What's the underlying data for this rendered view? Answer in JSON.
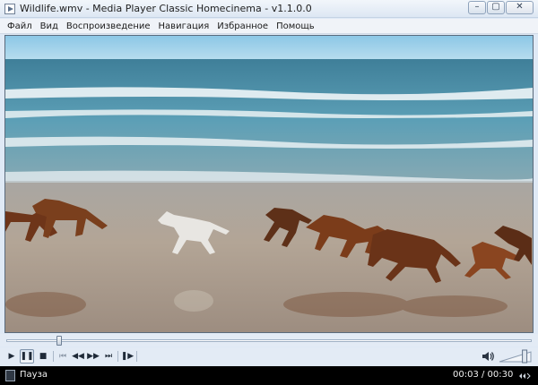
{
  "window": {
    "title": "Wildlife.wmv - Media Player Classic Homecinema - v1.1.0.0",
    "minimize_glyph": "–",
    "maximize_glyph": "▢",
    "close_glyph": "✕"
  },
  "menu": {
    "items": [
      "Файл",
      "Вид",
      "Воспроизведение",
      "Навигация",
      "Избранное",
      "Помощь"
    ]
  },
  "video": {
    "scene": "horses-running-on-beach"
  },
  "seek": {
    "position_fraction": 0.1
  },
  "controls": {
    "play_glyph": "▶",
    "pause_glyph": "❚❚",
    "stop_glyph": "■",
    "prev_glyph": "⏮",
    "rewind_glyph": "◀◀",
    "forward_glyph": "▶▶",
    "next_glyph": "⏭",
    "frame_step_glyph": "❚▶",
    "volume_level": 0.85
  },
  "status": {
    "state": "Пауза",
    "time": "00:03 / 00:30"
  },
  "colors": {
    "sky": "#9fd0ea",
    "sea": "#4f9ab3",
    "foam": "#f2f7f8",
    "sand": "#a99f95",
    "horse_brown": "#7a3f1d",
    "horse_white": "#e6e6e6"
  }
}
